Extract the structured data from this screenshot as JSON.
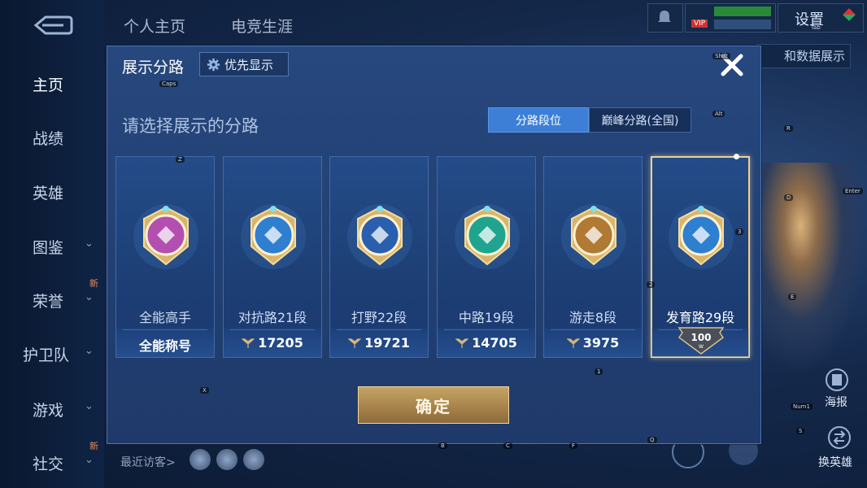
{
  "background": {
    "sidebar": [
      {
        "label": "主页",
        "active": true
      },
      {
        "label": "战绩"
      },
      {
        "label": "英雄"
      },
      {
        "label": "图鉴"
      },
      {
        "label": "荣誉"
      },
      {
        "label": "护卫队"
      },
      {
        "label": "游戏"
      },
      {
        "label": "社交"
      }
    ],
    "sidebar_new_badge": "新",
    "top_tabs": [
      "个人主页",
      "电竞生涯"
    ],
    "settings_label": "设置",
    "settings_hotkey": "Tab",
    "right_data_label": "和数据展示",
    "poster_label": "海报",
    "switch_hero_label": "换英雄",
    "recent_visitors_label": "最近访客>",
    "vip_label": "VIP"
  },
  "dialog": {
    "title": "展示分路",
    "priority_button": "优先显示",
    "section_header": "请选择展示的分路",
    "segments": {
      "left": "分路段位",
      "right": "巅峰分路(全国)"
    },
    "cards": [
      {
        "role": "全能高手",
        "points": "全能称号",
        "emblem_color": "#b34fb0",
        "selected": false
      },
      {
        "role": "对抗路21段",
        "points": "17205",
        "emblem_color": "#2f7fd1",
        "selected": false
      },
      {
        "role": "打野22段",
        "points": "19721",
        "emblem_color": "#2a5fb0",
        "selected": false
      },
      {
        "role": "中路19段",
        "points": "14705",
        "emblem_color": "#1fa58f",
        "selected": false
      },
      {
        "role": "游走8段",
        "points": "3975",
        "emblem_color": "#b07a34",
        "selected": false
      },
      {
        "role": "发育路29段",
        "points": "",
        "emblem_color": "#2f7fd1",
        "selected": true,
        "rank_badge": "100",
        "rank_badge_sub": "W"
      }
    ],
    "confirm_button": "确定"
  },
  "key_hints": [
    "Caps",
    "Shift",
    "Alt",
    "Z",
    "X",
    "R",
    "D",
    "E",
    "Enter",
    "Q",
    "S",
    "Num1",
    "B",
    "C",
    "F",
    "1",
    "2",
    "3"
  ]
}
